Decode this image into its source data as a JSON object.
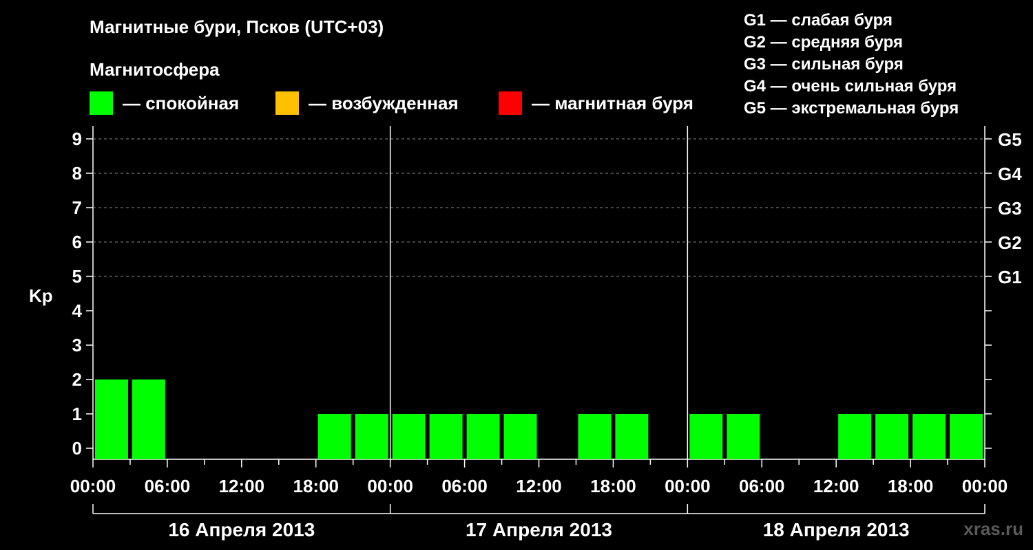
{
  "title": "Магнитные бури, Псков (UTC+03)",
  "subtitle": "Магнитосфера",
  "legend": [
    {
      "label": "— спокойная",
      "color": "#00ff00"
    },
    {
      "label": "— возбужденная",
      "color": "#ffc000"
    },
    {
      "label": "— магнитная буря",
      "color": "#ff0000"
    }
  ],
  "g_legend": [
    "G1 — слабая буря",
    "G2 — средняя буря",
    "G3 — сильная буря",
    "G4 — очень сильная буря",
    "G5 — экстремальная буря"
  ],
  "watermark": "xras.ru",
  "chart_data": {
    "type": "bar",
    "ylabel": "Kp",
    "ylim": [
      0,
      9
    ],
    "y_ticks": [
      "0",
      "1",
      "2",
      "3",
      "4",
      "5",
      "6",
      "7",
      "8",
      "9"
    ],
    "right_ticks": [
      {
        "kp": 5,
        "label": "G1"
      },
      {
        "kp": 6,
        "label": "G2"
      },
      {
        "kp": 7,
        "label": "G3"
      },
      {
        "kp": 8,
        "label": "G4"
      },
      {
        "kp": 9,
        "label": "G5"
      }
    ],
    "x_tick_labels": [
      "00:00",
      "06:00",
      "12:00",
      "18:00",
      "00:00",
      "06:00",
      "12:00",
      "18:00",
      "00:00",
      "06:00",
      "12:00",
      "18:00",
      "00:00"
    ],
    "days": [
      "16 Апреля 2013",
      "17 Апреля 2013",
      "18 Апреля 2013"
    ],
    "interval_hours": 3,
    "grid": true,
    "series": [
      {
        "values": [
          2,
          2,
          0,
          0,
          0,
          0,
          1,
          1,
          1,
          1,
          1,
          1,
          0,
          1,
          1,
          0,
          1,
          1,
          0,
          0,
          1,
          1,
          1,
          1
        ]
      }
    ],
    "color_thresholds": {
      "calm": "#00ff00",
      "excited": "#ffc000",
      "storm": "#ff0000"
    }
  }
}
